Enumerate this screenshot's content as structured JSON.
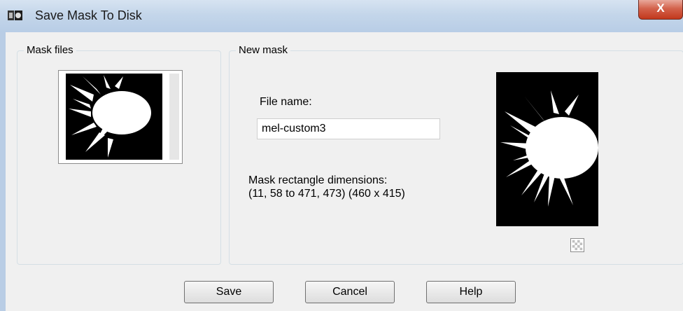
{
  "window": {
    "title": "Save Mask To Disk",
    "close_label": "X"
  },
  "mask_files": {
    "group_label": "Mask files"
  },
  "new_mask": {
    "group_label": "New mask",
    "file_name_label": "File name:",
    "file_name_value": "mel-custom3",
    "dimensions_label": "Mask rectangle dimensions:",
    "dimensions_value": "(11, 58 to 471, 473) (460 x 415)"
  },
  "buttons": {
    "save": "Save",
    "cancel": "Cancel",
    "help": "Help"
  },
  "icons": {
    "app": "mask-app-icon",
    "transparency": "checkerboard-icon"
  }
}
